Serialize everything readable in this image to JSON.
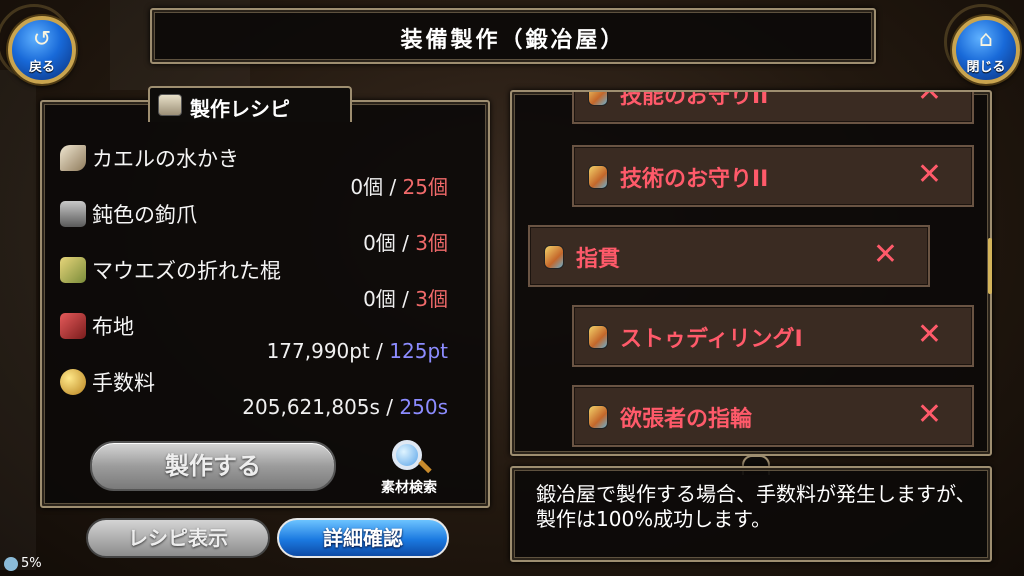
{
  "header": {
    "title": "装備製作（鍛冶屋）"
  },
  "nav": {
    "back_label": "戻る",
    "close_label": "閉じる",
    "back_icon": "back-arrow-icon",
    "close_icon": "home-icon"
  },
  "recipe": {
    "tab_label": "製作レシピ",
    "materials": [
      {
        "name": "カエルの水かき",
        "owned": "0個",
        "sep": "/",
        "required": "25個",
        "icon": "claw-icon",
        "req_color": "#f06a6a"
      },
      {
        "name": "鈍色の鉤爪",
        "owned": "0個",
        "sep": "/",
        "required": "3個",
        "icon": "metal-ingot-icon",
        "req_color": "#f06a6a"
      },
      {
        "name": "マウエズの折れた棍",
        "owned": "0個",
        "sep": "/",
        "required": "3個",
        "icon": "broken-club-icon",
        "req_color": "#f06a6a"
      },
      {
        "name": "布地",
        "owned": "177,990pt",
        "sep": "/",
        "required": "125pt",
        "icon": "cloth-icon",
        "req_color": "#8c8cff"
      },
      {
        "name": "手数料",
        "owned": "205,621,805s",
        "sep": "/",
        "required": "250s",
        "icon": "coins-icon",
        "req_color": "#8c8cff"
      }
    ],
    "craft_button": "製作する",
    "search_label": "素材検索",
    "recipe_display_button": "レシピ表示",
    "details_button": "詳細確認"
  },
  "item_list": {
    "items": [
      {
        "name": "技能のお守りII",
        "mark": "✕"
      },
      {
        "name": "技術のお守りII",
        "mark": "✕"
      },
      {
        "name": "指貫",
        "mark": "✕"
      },
      {
        "name": "ストゥディリングI",
        "mark": "✕"
      },
      {
        "name": "欲張者の指輪",
        "mark": "✕"
      }
    ]
  },
  "message": {
    "text": "鍛冶屋で製作する場合、手数料が発生しますが、製作は100%成功します。"
  },
  "status": {
    "battery": "5%"
  }
}
